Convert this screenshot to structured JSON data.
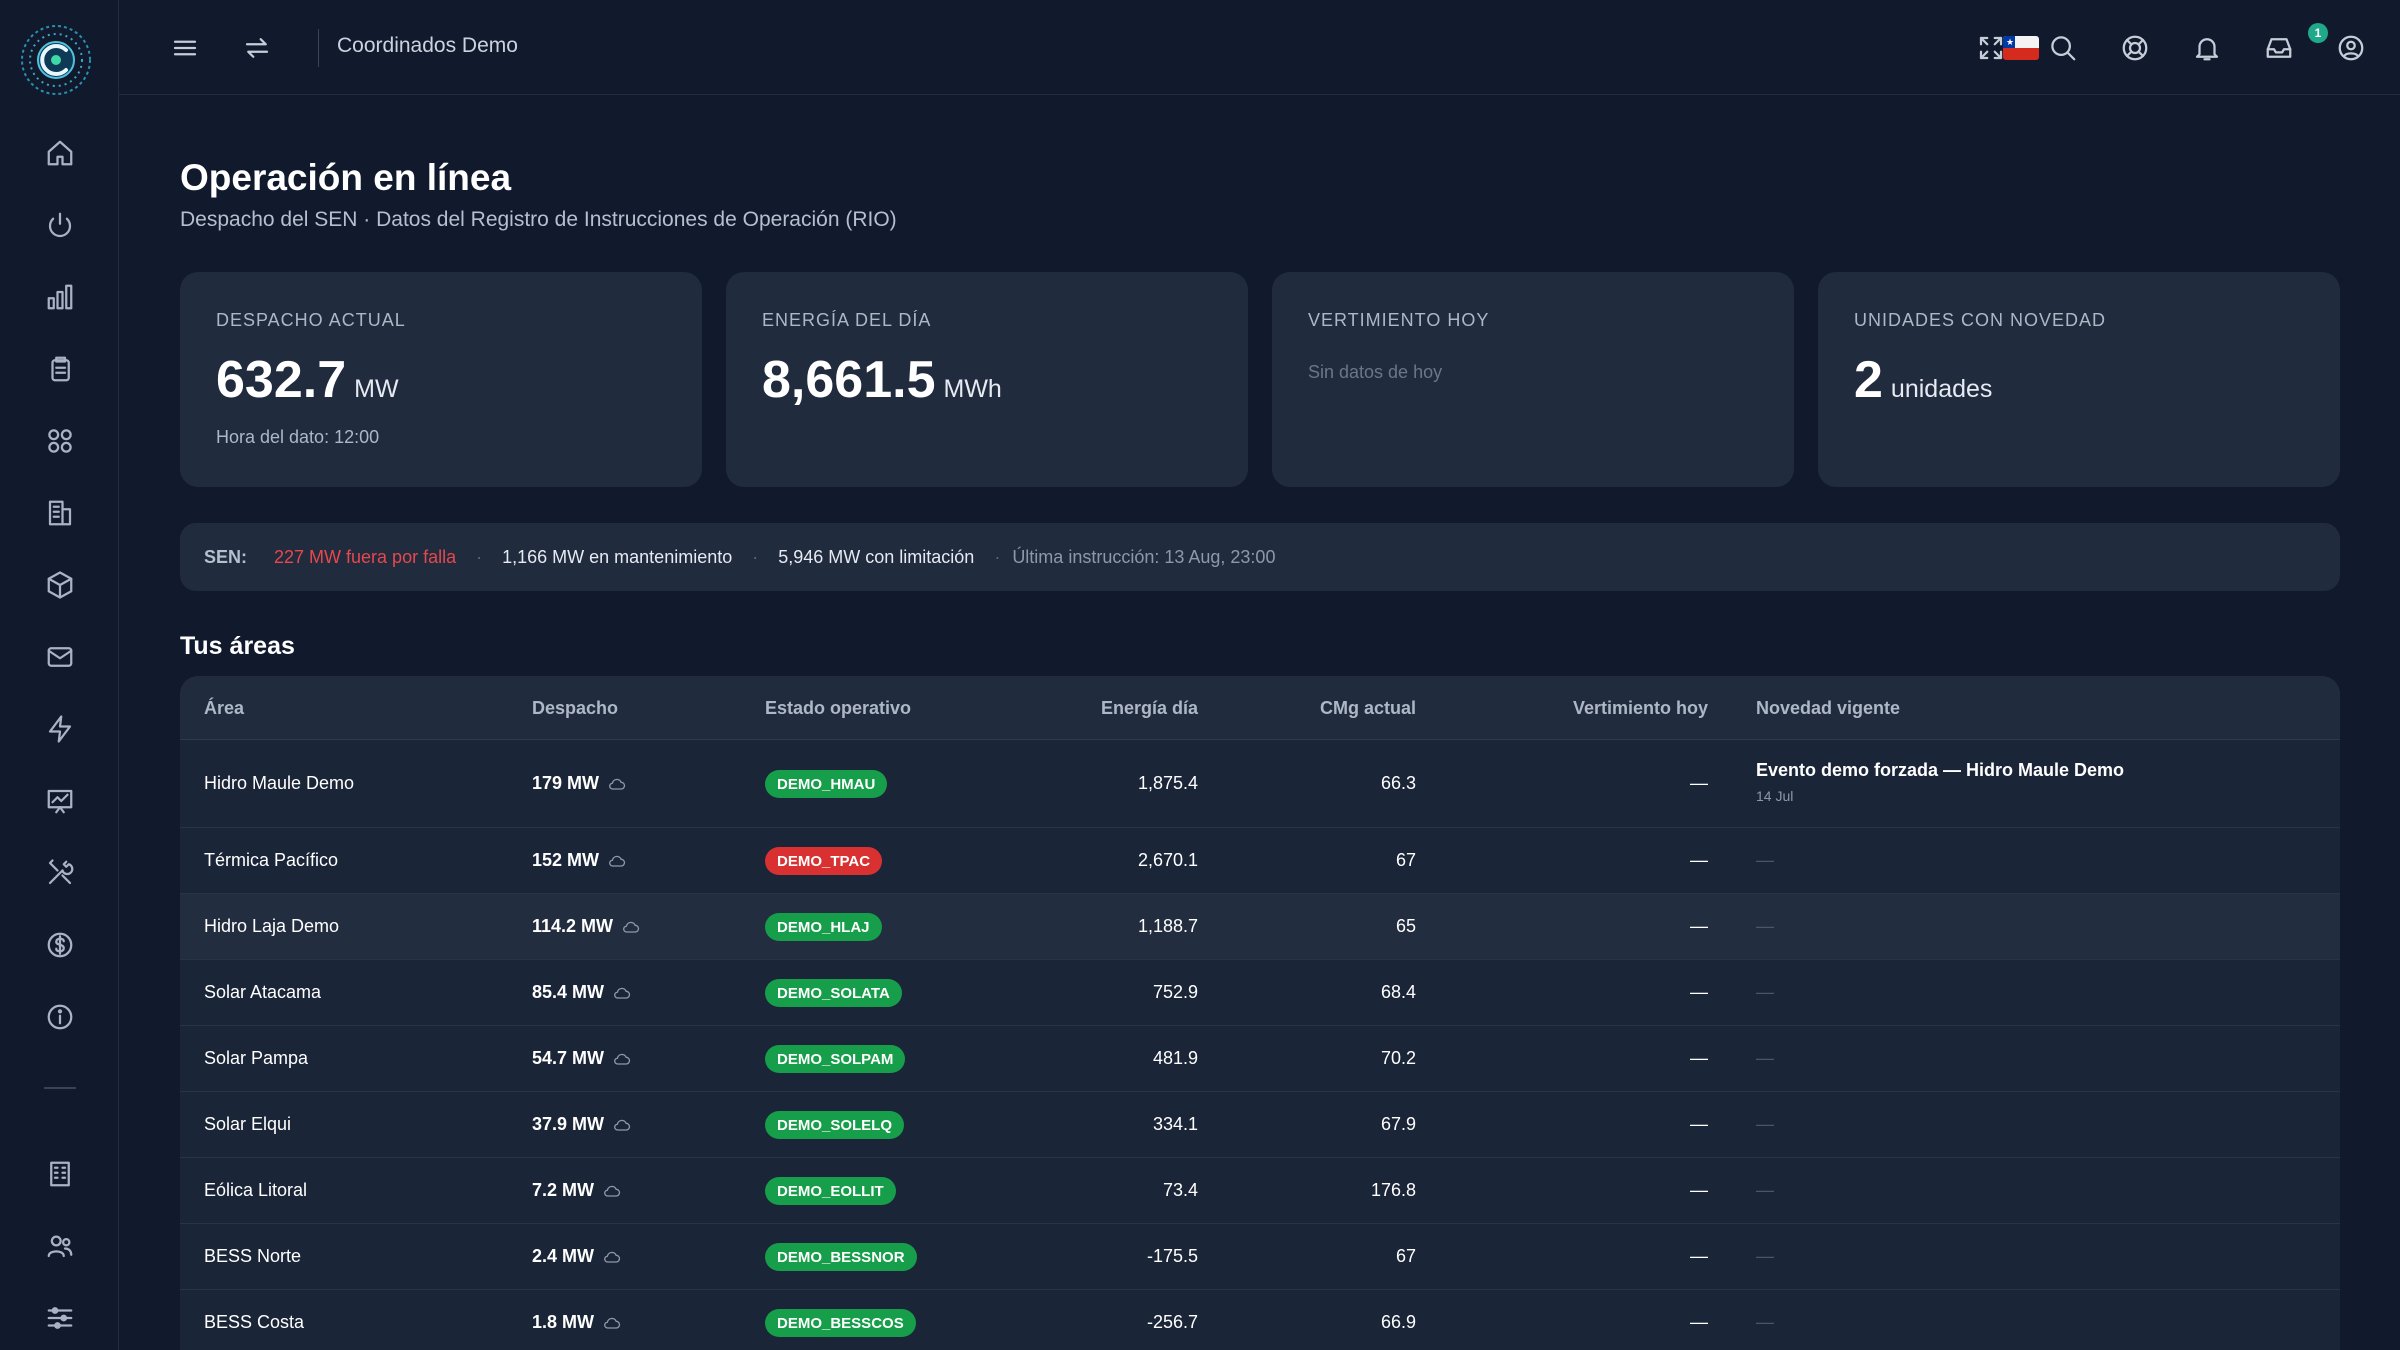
{
  "app": {
    "top_title": "Coordinados Demo",
    "notification_count": "1"
  },
  "page": {
    "title": "Operación en línea",
    "subtitle": "Despacho del SEN · Datos del Registro de Instrucciones de Operación (RIO)"
  },
  "cards": [
    {
      "label": "DESPACHO ACTUAL",
      "value": "632.7",
      "unit": "MW",
      "foot": "Hora del dato: 12:00"
    },
    {
      "label": "ENERGÍA DEL DÍA",
      "value": "8,661.5",
      "unit": "MWh"
    },
    {
      "label": "VERTIMIENTO HOY",
      "empty": "Sin datos de hoy"
    },
    {
      "label": "UNIDADES CON NOVEDAD",
      "value": "2",
      "unit": "unidades"
    }
  ],
  "sen": {
    "label": "SEN:",
    "fail": "227 MW fuera por falla",
    "maint": "1,166 MW en mantenimiento",
    "limit": "5,946 MW con limitación",
    "last": "Última instrucción: 13 Aug, 23:00"
  },
  "areas": {
    "title": "Tus áreas",
    "headers": [
      "Área",
      "Despacho",
      "Estado operativo",
      "Energía día",
      "CMg actual",
      "Vertimiento hoy",
      "Novedad vigente"
    ],
    "rows": [
      {
        "area": "Hidro Maule Demo",
        "despacho": "179 MW",
        "estado": "DEMO_HMAU",
        "estado_color": "green",
        "energia": "1,875.4",
        "cmg": "66.3",
        "vert": "—",
        "novedad": "Evento demo forzada — Hidro Maule Demo",
        "novedad_fecha": "14 Jul"
      },
      {
        "area": "Térmica Pacífico",
        "despacho": "152 MW",
        "estado": "DEMO_TPAC",
        "estado_color": "red",
        "energia": "2,670.1",
        "cmg": "67",
        "vert": "—",
        "novedad": "—"
      },
      {
        "area": "Hidro Laja Demo",
        "despacho": "114.2 MW",
        "estado": "DEMO_HLAJ",
        "estado_color": "green",
        "energia": "1,188.7",
        "cmg": "65",
        "vert": "—",
        "novedad": "—"
      },
      {
        "area": "Solar Atacama",
        "despacho": "85.4 MW",
        "estado": "DEMO_SOLATA",
        "estado_color": "green",
        "energia": "752.9",
        "cmg": "68.4",
        "vert": "—",
        "novedad": "—"
      },
      {
        "area": "Solar Pampa",
        "despacho": "54.7 MW",
        "estado": "DEMO_SOLPAM",
        "estado_color": "green",
        "energia": "481.9",
        "cmg": "70.2",
        "vert": "—",
        "novedad": "—"
      },
      {
        "area": "Solar Elqui",
        "despacho": "37.9 MW",
        "estado": "DEMO_SOLELQ",
        "estado_color": "green",
        "energia": "334.1",
        "cmg": "67.9",
        "vert": "—",
        "novedad": "—"
      },
      {
        "area": "Eólica Litoral",
        "despacho": "7.2 MW",
        "estado": "DEMO_EOLLIT",
        "estado_color": "green",
        "energia": "73.4",
        "cmg": "176.8",
        "vert": "—",
        "novedad": "—"
      },
      {
        "area": "BESS Norte",
        "despacho": "2.4 MW",
        "estado": "DEMO_BESSNOR",
        "estado_color": "green",
        "energia": "-175.5",
        "cmg": "67",
        "vert": "—",
        "novedad": "—"
      },
      {
        "area": "BESS Costa",
        "despacho": "1.8 MW",
        "estado": "DEMO_BESSCOS",
        "estado_color": "green",
        "energia": "-256.7",
        "cmg": "66.9",
        "vert": "—",
        "novedad": "—"
      }
    ]
  },
  "icons": {
    "sidebar": [
      "home-icon",
      "power-icon",
      "bar-chart-icon",
      "clipboard-icon",
      "grid-icon",
      "building-icon",
      "cube-icon",
      "mail-icon",
      "bolt-icon",
      "trend-chart-icon",
      "tools-icon",
      "dollar-icon",
      "info-icon",
      "office-icon",
      "users-icon",
      "sliders-icon"
    ],
    "topbar": [
      "menu-icon",
      "swap-icon",
      "chile-flag-icon",
      "fullscreen-icon",
      "search-icon",
      "support-icon",
      "bell-icon",
      "inbox-icon",
      "user-icon"
    ]
  },
  "colors": {
    "background": "#111a2d",
    "card": "#212b3e",
    "accent": "#1fa88a",
    "status_green": "#169e4a",
    "status_red": "#d93131",
    "fail_text": "#e5484d"
  }
}
